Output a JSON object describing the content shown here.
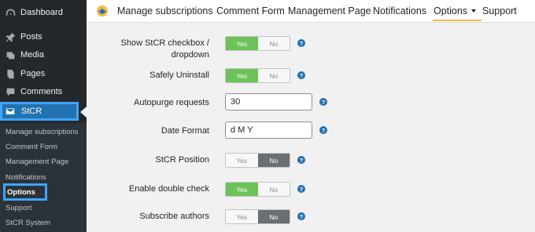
{
  "sidebar": {
    "items": [
      {
        "label": "Dashboard",
        "icon": "dashboard-icon"
      },
      {
        "label": "Posts",
        "icon": "pin-icon"
      },
      {
        "label": "Media",
        "icon": "media-icon"
      },
      {
        "label": "Pages",
        "icon": "pages-icon"
      },
      {
        "label": "Comments",
        "icon": "comment-icon"
      }
    ],
    "active": {
      "label": "StCR",
      "icon": "envelope-icon"
    },
    "submenu": [
      "Manage subscriptions",
      "Comment Form",
      "Management Page",
      "Notifications",
      "Options",
      "Support",
      "StCR System"
    ]
  },
  "topnav": {
    "items": [
      "Manage subscriptions",
      "Comment Form",
      "Management Page",
      "Notifications",
      "Options",
      "Support"
    ],
    "active": "Options"
  },
  "form": {
    "rows": [
      {
        "label_line1": "Show StCR checkbox /",
        "label_line2": "dropdown",
        "type": "toggle",
        "value": "Yes"
      },
      {
        "label": "Safely Uninstall",
        "type": "toggle",
        "value": "Yes"
      },
      {
        "label": "Autopurge requests",
        "type": "text",
        "value": "30"
      },
      {
        "label": "Date Format",
        "type": "text",
        "value": "d M Y"
      },
      {
        "label": "StCR Position",
        "type": "toggle",
        "value": "No"
      },
      {
        "label": "Enable double check",
        "type": "toggle",
        "value": "Yes"
      },
      {
        "label": "Subscribe authors",
        "type": "toggle",
        "value": "No"
      }
    ],
    "yes_label": "Yes",
    "no_label": "No",
    "help_glyph": "?"
  },
  "colors": {
    "sidebar_bg": "#23282d",
    "active_bg": "#2271b1",
    "highlight_border": "#3fa5ff",
    "toggle_yes": "#6dc25a",
    "toggle_no": "#6b6f73",
    "help": "#2271b1",
    "nav_underline": "#f0b849"
  }
}
